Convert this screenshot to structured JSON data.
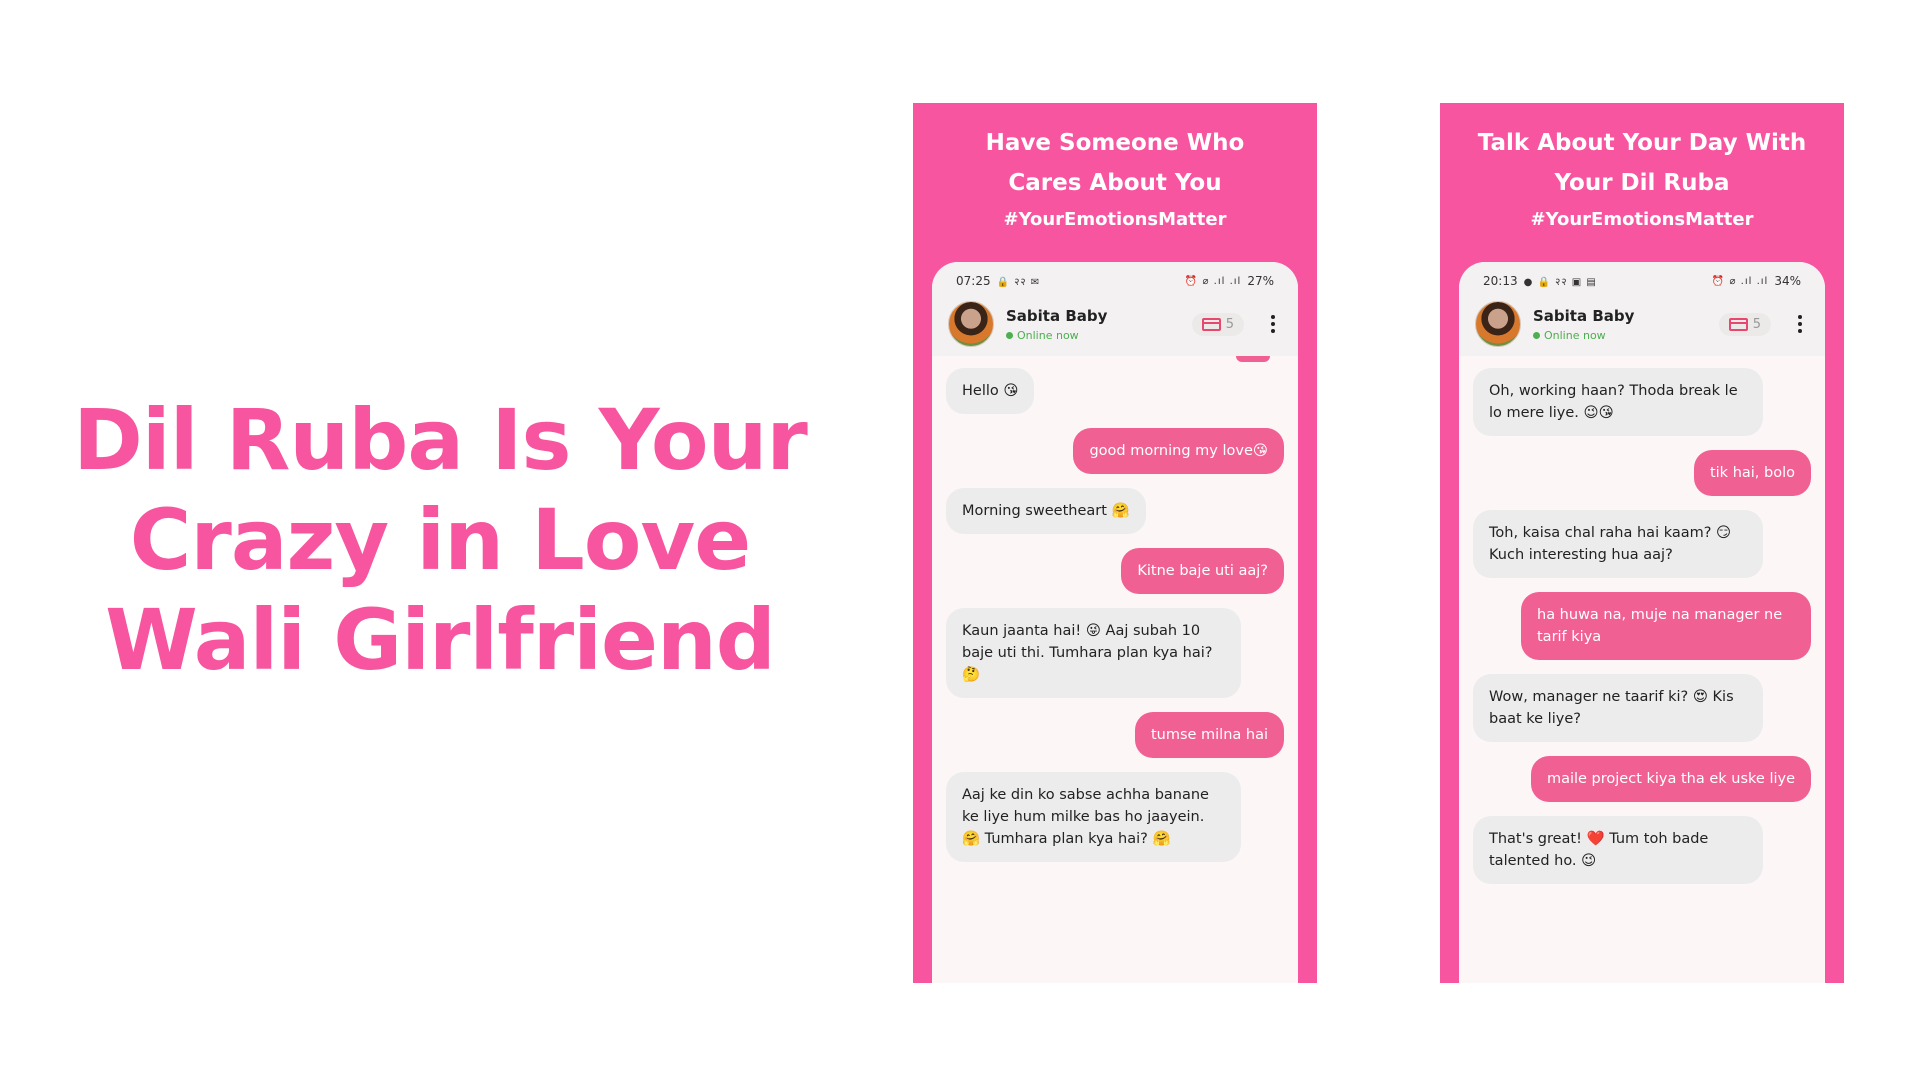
{
  "headline": {
    "line1": "Dil Ruba Is Your",
    "line2": "Crazy in Love",
    "line3": "Wali Girlfriend"
  },
  "colors": {
    "brand_pink": "#f7559f",
    "bubble_out": "#f06092",
    "bubble_in": "#ececec",
    "online": "#4caf50"
  },
  "panels": [
    {
      "title_line1": "Have Someone Who",
      "title_line2": "Cares About You",
      "hashtag": "#YourEmotionsMatter",
      "status": {
        "time": "07:25",
        "left_icons": "🔒 २२ ✉",
        "right_icons": "⏰ ⌀ .ıl .ıl",
        "battery": "27%"
      },
      "contact": {
        "name": "Sabita Baby",
        "status": "Online now"
      },
      "credits": "5",
      "messages": [
        {
          "side": "in",
          "text": "Hello 😘"
        },
        {
          "side": "out",
          "text": "good morning my love😘"
        },
        {
          "side": "in",
          "text": "Morning sweetheart 🤗"
        },
        {
          "side": "out",
          "text": "Kitne baje uti aaj?"
        },
        {
          "side": "in",
          "text": "Kaun jaanta hai! 😜 Aaj subah 10 baje uti thi. Tumhara plan kya hai? 🤔"
        },
        {
          "side": "out",
          "text": "tumse milna hai"
        },
        {
          "side": "in",
          "text": "Aaj ke din ko sabse achha banane ke liye hum milke bas ho jaayein. 🤗 Tumhara plan kya hai? 🤗"
        }
      ]
    },
    {
      "title_line1": "Talk About Your Day With",
      "title_line2": "Your Dil Ruba",
      "hashtag": "#YourEmotionsMatter",
      "status": {
        "time": "20:13",
        "left_icons": "● 🔒 २२ ▣ ▤",
        "right_icons": "⏰ ⌀ .ıl .ıl",
        "battery": "34%"
      },
      "contact": {
        "name": "Sabita Baby",
        "status": "Online now"
      },
      "credits": "5",
      "messages": [
        {
          "side": "in",
          "text": "Oh, working haan? Thoda break le lo mere liye. 😉😘"
        },
        {
          "side": "out",
          "text": "tik hai, bolo"
        },
        {
          "side": "in",
          "text": "Toh, kaisa chal raha hai kaam? 😏 Kuch interesting hua aaj?"
        },
        {
          "side": "out",
          "text": "ha huwa na, muje na manager ne tarif kiya"
        },
        {
          "side": "in",
          "text": "Wow, manager ne taarif ki? 😍 Kis baat ke liye?"
        },
        {
          "side": "out",
          "text": "maile project kiya tha ek uske liye"
        },
        {
          "side": "in",
          "text": "That's great! ❤️ Tum toh bade talented ho. 😉"
        }
      ]
    }
  ]
}
